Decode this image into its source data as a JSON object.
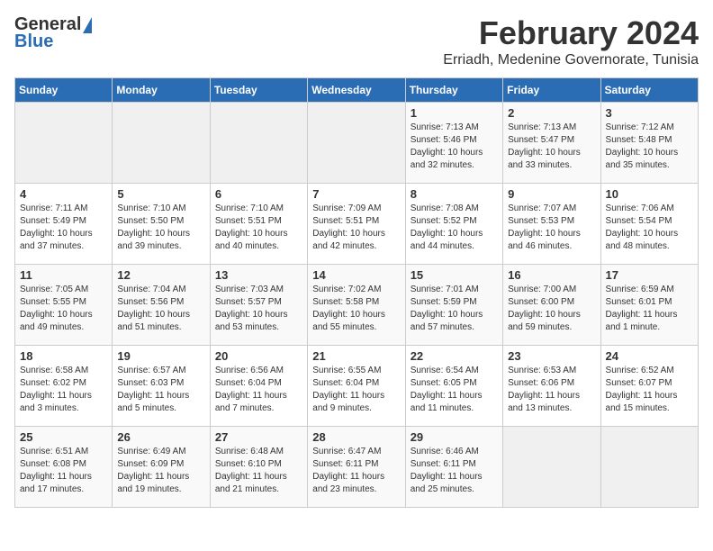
{
  "header": {
    "logo_general": "General",
    "logo_blue": "Blue",
    "month": "February 2024",
    "location": "Erriadh, Medenine Governorate, Tunisia"
  },
  "days_of_week": [
    "Sunday",
    "Monday",
    "Tuesday",
    "Wednesday",
    "Thursday",
    "Friday",
    "Saturday"
  ],
  "weeks": [
    [
      {
        "day": "",
        "info": ""
      },
      {
        "day": "",
        "info": ""
      },
      {
        "day": "",
        "info": ""
      },
      {
        "day": "",
        "info": ""
      },
      {
        "day": "1",
        "info": "Sunrise: 7:13 AM\nSunset: 5:46 PM\nDaylight: 10 hours\nand 32 minutes."
      },
      {
        "day": "2",
        "info": "Sunrise: 7:13 AM\nSunset: 5:47 PM\nDaylight: 10 hours\nand 33 minutes."
      },
      {
        "day": "3",
        "info": "Sunrise: 7:12 AM\nSunset: 5:48 PM\nDaylight: 10 hours\nand 35 minutes."
      }
    ],
    [
      {
        "day": "4",
        "info": "Sunrise: 7:11 AM\nSunset: 5:49 PM\nDaylight: 10 hours\nand 37 minutes."
      },
      {
        "day": "5",
        "info": "Sunrise: 7:10 AM\nSunset: 5:50 PM\nDaylight: 10 hours\nand 39 minutes."
      },
      {
        "day": "6",
        "info": "Sunrise: 7:10 AM\nSunset: 5:51 PM\nDaylight: 10 hours\nand 40 minutes."
      },
      {
        "day": "7",
        "info": "Sunrise: 7:09 AM\nSunset: 5:51 PM\nDaylight: 10 hours\nand 42 minutes."
      },
      {
        "day": "8",
        "info": "Sunrise: 7:08 AM\nSunset: 5:52 PM\nDaylight: 10 hours\nand 44 minutes."
      },
      {
        "day": "9",
        "info": "Sunrise: 7:07 AM\nSunset: 5:53 PM\nDaylight: 10 hours\nand 46 minutes."
      },
      {
        "day": "10",
        "info": "Sunrise: 7:06 AM\nSunset: 5:54 PM\nDaylight: 10 hours\nand 48 minutes."
      }
    ],
    [
      {
        "day": "11",
        "info": "Sunrise: 7:05 AM\nSunset: 5:55 PM\nDaylight: 10 hours\nand 49 minutes."
      },
      {
        "day": "12",
        "info": "Sunrise: 7:04 AM\nSunset: 5:56 PM\nDaylight: 10 hours\nand 51 minutes."
      },
      {
        "day": "13",
        "info": "Sunrise: 7:03 AM\nSunset: 5:57 PM\nDaylight: 10 hours\nand 53 minutes."
      },
      {
        "day": "14",
        "info": "Sunrise: 7:02 AM\nSunset: 5:58 PM\nDaylight: 10 hours\nand 55 minutes."
      },
      {
        "day": "15",
        "info": "Sunrise: 7:01 AM\nSunset: 5:59 PM\nDaylight: 10 hours\nand 57 minutes."
      },
      {
        "day": "16",
        "info": "Sunrise: 7:00 AM\nSunset: 6:00 PM\nDaylight: 10 hours\nand 59 minutes."
      },
      {
        "day": "17",
        "info": "Sunrise: 6:59 AM\nSunset: 6:01 PM\nDaylight: 11 hours\nand 1 minute."
      }
    ],
    [
      {
        "day": "18",
        "info": "Sunrise: 6:58 AM\nSunset: 6:02 PM\nDaylight: 11 hours\nand 3 minutes."
      },
      {
        "day": "19",
        "info": "Sunrise: 6:57 AM\nSunset: 6:03 PM\nDaylight: 11 hours\nand 5 minutes."
      },
      {
        "day": "20",
        "info": "Sunrise: 6:56 AM\nSunset: 6:04 PM\nDaylight: 11 hours\nand 7 minutes."
      },
      {
        "day": "21",
        "info": "Sunrise: 6:55 AM\nSunset: 6:04 PM\nDaylight: 11 hours\nand 9 minutes."
      },
      {
        "day": "22",
        "info": "Sunrise: 6:54 AM\nSunset: 6:05 PM\nDaylight: 11 hours\nand 11 minutes."
      },
      {
        "day": "23",
        "info": "Sunrise: 6:53 AM\nSunset: 6:06 PM\nDaylight: 11 hours\nand 13 minutes."
      },
      {
        "day": "24",
        "info": "Sunrise: 6:52 AM\nSunset: 6:07 PM\nDaylight: 11 hours\nand 15 minutes."
      }
    ],
    [
      {
        "day": "25",
        "info": "Sunrise: 6:51 AM\nSunset: 6:08 PM\nDaylight: 11 hours\nand 17 minutes."
      },
      {
        "day": "26",
        "info": "Sunrise: 6:49 AM\nSunset: 6:09 PM\nDaylight: 11 hours\nand 19 minutes."
      },
      {
        "day": "27",
        "info": "Sunrise: 6:48 AM\nSunset: 6:10 PM\nDaylight: 11 hours\nand 21 minutes."
      },
      {
        "day": "28",
        "info": "Sunrise: 6:47 AM\nSunset: 6:11 PM\nDaylight: 11 hours\nand 23 minutes."
      },
      {
        "day": "29",
        "info": "Sunrise: 6:46 AM\nSunset: 6:11 PM\nDaylight: 11 hours\nand 25 minutes."
      },
      {
        "day": "",
        "info": ""
      },
      {
        "day": "",
        "info": ""
      }
    ]
  ]
}
